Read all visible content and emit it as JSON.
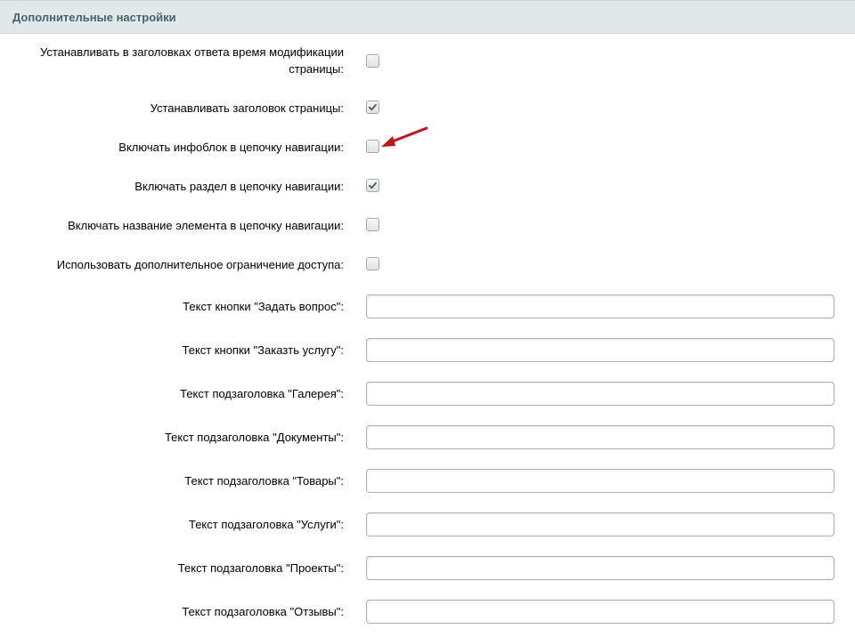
{
  "section": {
    "title": "Дополнительные настройки"
  },
  "checkbox_rows": [
    {
      "label": "Устанавливать в заголовках ответа время модификации страницы:",
      "checked": false
    },
    {
      "label": "Устанавливать заголовок страницы:",
      "checked": true
    },
    {
      "label": "Включать инфоблок в цепочку навигации:",
      "checked": false
    },
    {
      "label": "Включать раздел в цепочку навигации:",
      "checked": true
    },
    {
      "label": "Включать название элемента в цепочку навигации:",
      "checked": false
    },
    {
      "label": "Использовать дополнительное ограничение доступа:",
      "checked": false
    }
  ],
  "text_rows": [
    {
      "label": "Текст кнопки \"Задать вопрос\":",
      "value": ""
    },
    {
      "label": "Текст кнопки \"Заказть услугу\":",
      "value": ""
    },
    {
      "label": "Текст подзаголовка \"Галерея\":",
      "value": ""
    },
    {
      "label": "Текст подзаголовка \"Документы\":",
      "value": ""
    },
    {
      "label": "Текст подзаголовка \"Товары\":",
      "value": ""
    },
    {
      "label": "Текст подзаголовка \"Услуги\":",
      "value": ""
    },
    {
      "label": "Текст подзаголовка \"Проекты\":",
      "value": ""
    },
    {
      "label": "Текст подзаголовка \"Отзывы\":",
      "value": ""
    }
  ],
  "colors": {
    "header_bg": "#e0e8ea",
    "header_text": "#4b6267",
    "annotation_arrow": "#c0161b"
  },
  "icons": {
    "checkbox_mark": "check-mark-icon",
    "annotation": "red-arrow-icon"
  }
}
